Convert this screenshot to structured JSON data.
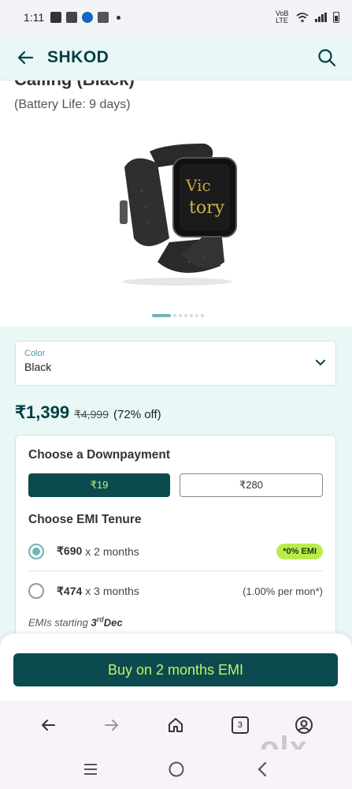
{
  "status_bar": {
    "time": "1:11",
    "network_label": "VoB LTE"
  },
  "app_bar": {
    "title": "SHKOD",
    "back_icon": "arrow-left-icon",
    "search_icon": "search-icon"
  },
  "product": {
    "name_partial": "Calling (Black)",
    "subtitle": "(Battery Life: 9 days)",
    "watch_face_text_1": "Vic",
    "watch_face_text_2": "tory",
    "image_count": 7,
    "active_image_index": 1
  },
  "color_select": {
    "label": "Color",
    "value": "Black"
  },
  "price": {
    "current": "₹1,399",
    "mrp": "₹4,999",
    "discount": "(72% off)"
  },
  "emi": {
    "downpayment_heading": "Choose a Downpayment",
    "downpayment_options": [
      "₹19",
      "₹280"
    ],
    "selected_downpayment": "₹19",
    "tenure_heading": "Choose EMI Tenure",
    "tenures": [
      {
        "amount": "₹690",
        "months": "x 2 months",
        "tag": "*0% EMI",
        "selected": true
      },
      {
        "amount": "₹474",
        "months": "x 3 months",
        "tag": "(1.00% per mon*)",
        "selected": false
      }
    ],
    "start_prefix": "EMIs starting",
    "start_day": "3",
    "start_suffix": "rd",
    "start_month": "Dec"
  },
  "buy_button": {
    "label": "Buy on 2 months EMI"
  },
  "browser_bar": {
    "tab_count": "3"
  },
  "watermark": "olx",
  "colors": {
    "brand_dark": "#0b4a4e",
    "brand_accent": "#c6f06a",
    "badge_green": "#b9ec4a",
    "radio_teal": "#6fb3b8"
  }
}
